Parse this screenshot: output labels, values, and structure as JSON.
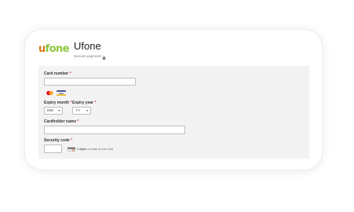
{
  "brand": {
    "logo_first": "u",
    "logo_rest": "fone",
    "logo_colors": {
      "first": "#d97a14",
      "rest": "#8bc63e"
    }
  },
  "header": {
    "title": "Ufone",
    "secure_label": "Secure payment",
    "secure_icon": "lock-icon"
  },
  "form": {
    "card_number": {
      "label": "Card number",
      "required_mark": "*",
      "value": ""
    },
    "card_brands": [
      "mastercard-icon",
      "visa-icon"
    ],
    "visa_text": "VISA",
    "expiry_month": {
      "label": "Expiry month",
      "required_mark": "*",
      "selected": "MM"
    },
    "expiry_year": {
      "label": "Expiry year",
      "required_mark": "*",
      "selected": "YY"
    },
    "cardholder_name": {
      "label": "Cardholder name",
      "required_mark": "*",
      "value": ""
    },
    "security_code": {
      "label": "Security code",
      "required_mark": "*",
      "value": "",
      "hint_strong": "3 digits",
      "hint_rest": " on back of your card"
    }
  },
  "colors": {
    "panel_bg": "#f3f3f3",
    "required": "#d93025"
  }
}
